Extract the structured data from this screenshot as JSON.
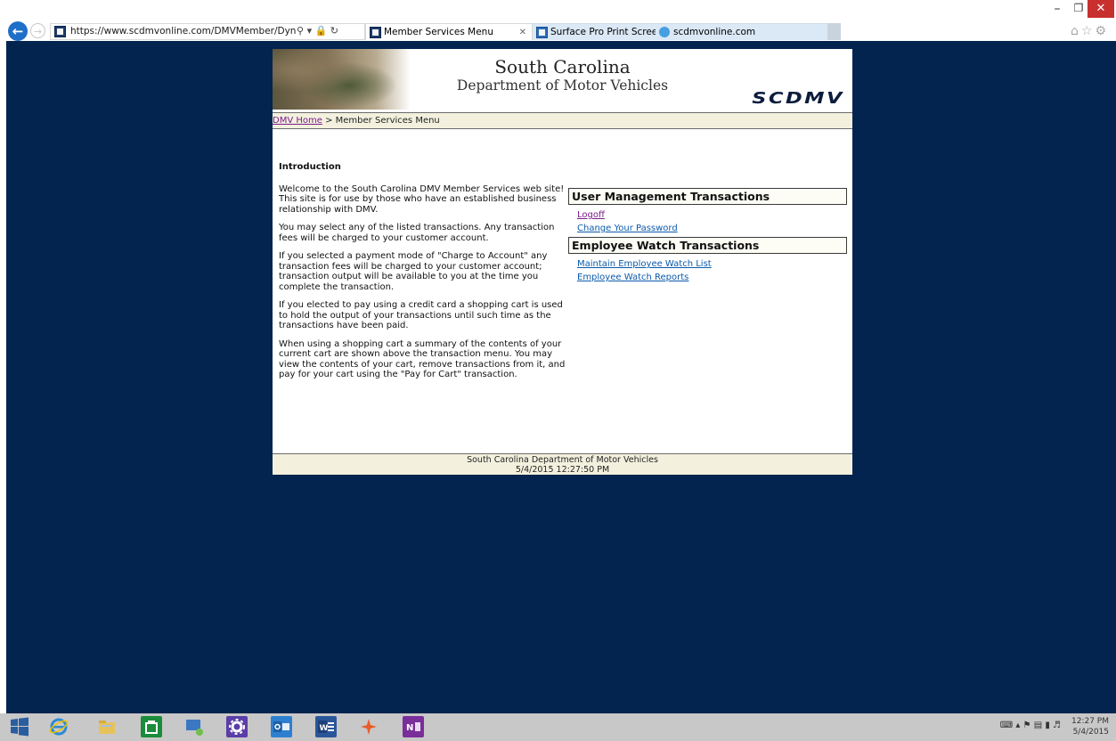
{
  "browser": {
    "url": "https://www.scdmvonline.com/DMVMember/DynMenu.asp",
    "tabs": [
      {
        "title": "Member Services Menu"
      },
      {
        "title": "Surface Pro Print Screen | Micro..."
      },
      {
        "title": "scdmvonline.com"
      }
    ]
  },
  "page": {
    "title": "South Carolina",
    "subtitle": "Department of Motor Vehicles",
    "logo": "SCDMV",
    "breadcrumb": {
      "home_label": "DMV Home",
      "separator": ">",
      "current": "Member Services Menu"
    },
    "intro": {
      "heading": "Introduction",
      "paragraphs": [
        "Welcome to the South Carolina DMV Member Services web site! This site is for use by those who have an established business relationship with DMV.",
        "You may select any of the listed transactions. Any transaction fees will be charged to your customer account.",
        "If you selected a payment mode of \"Charge to Account\" any transaction fees will be charged to your customer account; transaction output will be available to you at the time you complete the transaction.",
        "If you elected to pay using a credit card a shopping cart is used to hold the output of your transactions until such time as the transactions have been paid.",
        "When using a shopping cart a summary of the contents of your current cart are shown above the transaction menu. You may view the contents of your cart, remove transactions from it, and pay for your cart using the \"Pay for Cart\" transaction."
      ]
    },
    "menu": {
      "sections": [
        {
          "title": "User Management Transactions",
          "links": [
            "Logoff",
            "Change Your Password"
          ]
        },
        {
          "title": "Employee Watch Transactions",
          "links": [
            "Maintain Employee Watch List",
            "Employee Watch Reports"
          ]
        }
      ]
    },
    "footer": {
      "line1": "South Carolina Department of Motor Vehicles",
      "line2": "5/4/2015 12:27:50 PM"
    }
  },
  "taskbar": {
    "clock_time": "12:27 PM",
    "clock_date": "5/4/2015",
    "apps": [
      "windows-start",
      "internet-explorer",
      "file-explorer",
      "store",
      "remote-desktop",
      "settings",
      "outlook",
      "word",
      "snipping-tool",
      "onenote"
    ]
  },
  "colors": {
    "viewport_bg": "#03244f",
    "link": "#0a5aab",
    "visited_link": "#7b1d8c",
    "bar_bg": "#f3f1de"
  }
}
